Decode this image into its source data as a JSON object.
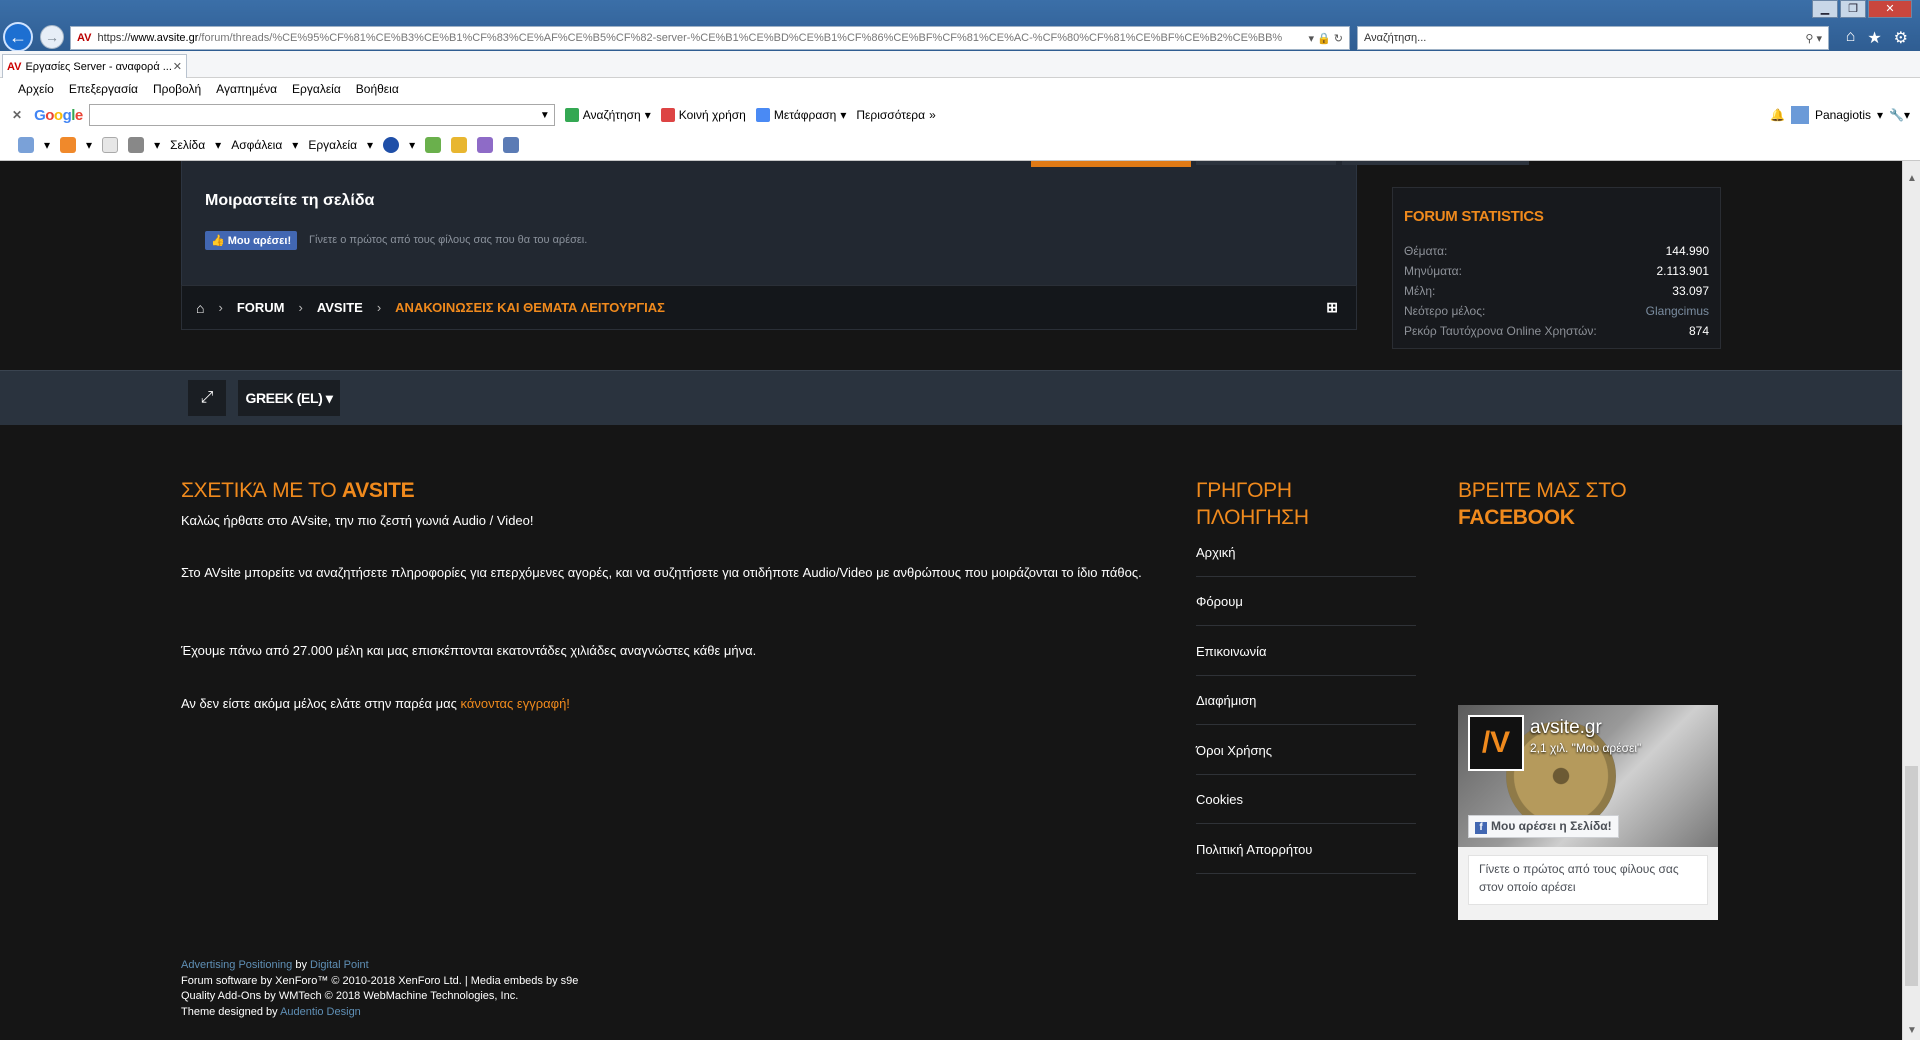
{
  "browser": {
    "url_prefix": "https://",
    "url_host": "www.avsite.gr",
    "url_path": "/forum/threads/%CE%95%CF%81%CE%B3%CE%B1%CF%83%CE%AF%CE%B5%CF%82-server-%CE%B1%CE%BD%CE%B1%CF%86%CE%BF%CF%81%CE%AC-%CF%80%CF%81%CE%BF%CE%B2%CE%BB%",
    "search_placeholder": "Αναζήτηση...",
    "tab_title": "Εργασίες Server - αναφορά ...",
    "site_badge": "AV",
    "menu": [
      "Αρχείο",
      "Επεξεργασία",
      "Προβολή",
      "Αγαπημένα",
      "Εργαλεία",
      "Βοήθεια"
    ],
    "google": {
      "search_label": "Αναζήτηση",
      "share_label": "Κοινή χρήση",
      "translate_label": "Μετάφραση",
      "more_label": "Περισσότερα",
      "user": "Panagiotis"
    },
    "command_bar": {
      "page_label": "Σελίδα",
      "safety_label": "Ασφάλεια",
      "tools_label": "Εργαλεία"
    }
  },
  "share": {
    "title": "Μοιραστείτε τη σελίδα",
    "like_label": "Μου αρέσει!",
    "like_note": "Γίνετε ο πρώτος από τους φίλους σας που θα του αρέσει."
  },
  "breadcrumb": [
    "FORUM",
    "AVSITE",
    "ΑΝΑΚΟΙΝΩΣΕΙΣ ΚΑΙ ΘΕΜΑΤΑ ΛΕΙΤΟΥΡΓΙΑΣ"
  ],
  "stats": {
    "title": "FORUM STATISTICS",
    "rows": [
      {
        "label": "Θέματα:",
        "value": "144.990"
      },
      {
        "label": "Μηνύματα:",
        "value": "2.113.901"
      },
      {
        "label": "Μέλη:",
        "value": "33.097"
      },
      {
        "label": "Νεότερο μέλος:",
        "value": "Glangcimus"
      },
      {
        "label": "Ρεκόρ Ταυτόχρονα Online Χρηστών:",
        "value": "874"
      }
    ]
  },
  "language": {
    "label": "GREEK (EL)"
  },
  "about": {
    "heading_prefix": "ΣΧΕΤΙΚΆ ΜΕ ΤΟ ",
    "heading_brand": "AVSITE",
    "p1": "Καλώς ήρθατε στο AVsite, την πιο ζεστή γωνιά Audio / Video!",
    "p2": "Στο AVsite μπορείτε να αναζητήσετε πληροφορίες για επερχόμενες αγορές, και να συζητήσετε για οτιδήποτε Audio/Video με ανθρώπους που μοιράζονται το ίδιο πάθος.",
    "p3": "Έχουμε πάνω από 27.000 μέλη και μας επισκέπτονται εκατοντάδες χιλιάδες αναγνώστες κάθε μήνα.",
    "p4_text": "Αν δεν είστε ακόμα μέλος ελάτε στην παρέα μας ",
    "p4_link": "κάνοντας εγγραφή!"
  },
  "quicknav": {
    "heading_line1": "ΓΡΗΓΟΡΗ",
    "heading_line2": "ΠΛΟΗΓΗΣΗ",
    "items": [
      "Αρχική",
      "Φόρουμ",
      "Επικοινωνία",
      "Διαφήμιση",
      "Όροι Χρήσης",
      "Cookies",
      "Πολιτική Απορρήτου"
    ]
  },
  "facebook": {
    "heading_line1": "ΒΡΕΙΤΕ ΜΑΣ ΣΤΟ",
    "heading_line2": "FACEBOOK",
    "page_name": "avsite.gr",
    "likes": "2,1 χιλ. \"Μου αρέσει\"",
    "like_button": "Μου αρέσει η Σελίδα!",
    "note": "Γίνετε ο πρώτος από τους φίλους σας στον οποίο αρέσει",
    "logo_text": "/V"
  },
  "credits": {
    "line1_a": "Advertising Positioning",
    "line1_b": " by ",
    "line1_c": "Digital Point",
    "line2": "Forum software by XenForo™ © 2010-2018 XenForo Ltd. | Media embeds by s9e",
    "line3": "Quality Add-Ons by WMTech © 2018 WebMachine Technologies, Inc.",
    "line4_a": "Theme designed by ",
    "line4_b": "Audentio Design"
  }
}
